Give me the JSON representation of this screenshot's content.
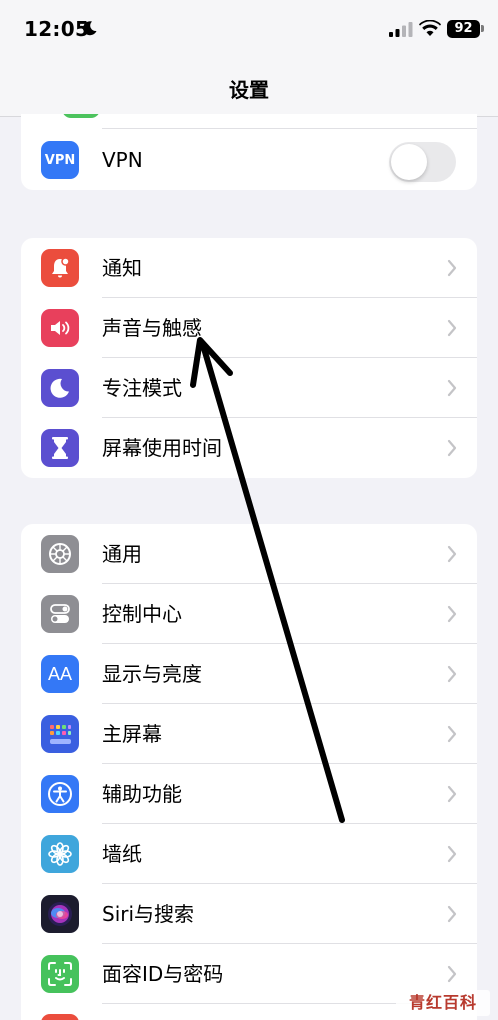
{
  "status_bar": {
    "time": "12:05",
    "battery": "92",
    "icons": [
      "moon-icon",
      "cellular-signal-icon",
      "wifi-icon",
      "battery-icon"
    ]
  },
  "nav": {
    "title": "设置"
  },
  "group1": {
    "vpn": {
      "label": "VPN",
      "icon_text": "VPN",
      "toggle_on": false
    }
  },
  "group2": {
    "items": [
      {
        "label": "通知",
        "icon": "bell-icon",
        "color": "#eb4d3d"
      },
      {
        "label": "声音与触感",
        "icon": "speaker-icon",
        "color": "#e8405c"
      },
      {
        "label": "专注模式",
        "icon": "moon-icon",
        "color": "#5b4fd0"
      },
      {
        "label": "屏幕使用时间",
        "icon": "hourglass-icon",
        "color": "#5b4fd0"
      }
    ]
  },
  "group3": {
    "items": [
      {
        "label": "通用",
        "icon": "gear-icon",
        "color": "#8e8e93"
      },
      {
        "label": "控制中心",
        "icon": "toggles-icon",
        "color": "#8e8e93"
      },
      {
        "label": "显示与亮度",
        "icon": "text-size-icon",
        "color": "#3478f6",
        "icon_text": "AA"
      },
      {
        "label": "主屏幕",
        "icon": "home-grid-icon",
        "color": "#3a5fe0"
      },
      {
        "label": "辅助功能",
        "icon": "accessibility-icon",
        "color": "#3478f6"
      },
      {
        "label": "墙纸",
        "icon": "flower-icon",
        "color": "#3fa6dc"
      },
      {
        "label": "Siri与搜索",
        "icon": "siri-icon",
        "color": "#1c1c2e"
      },
      {
        "label": "面容ID与密码",
        "icon": "face-id-icon",
        "color": "#46c25c"
      }
    ]
  },
  "watermark": {
    "text": "青红百科"
  },
  "colors": {
    "background": "#f2f2f7",
    "row_bg": "#ffffff",
    "chevron": "#c4c4c7"
  }
}
